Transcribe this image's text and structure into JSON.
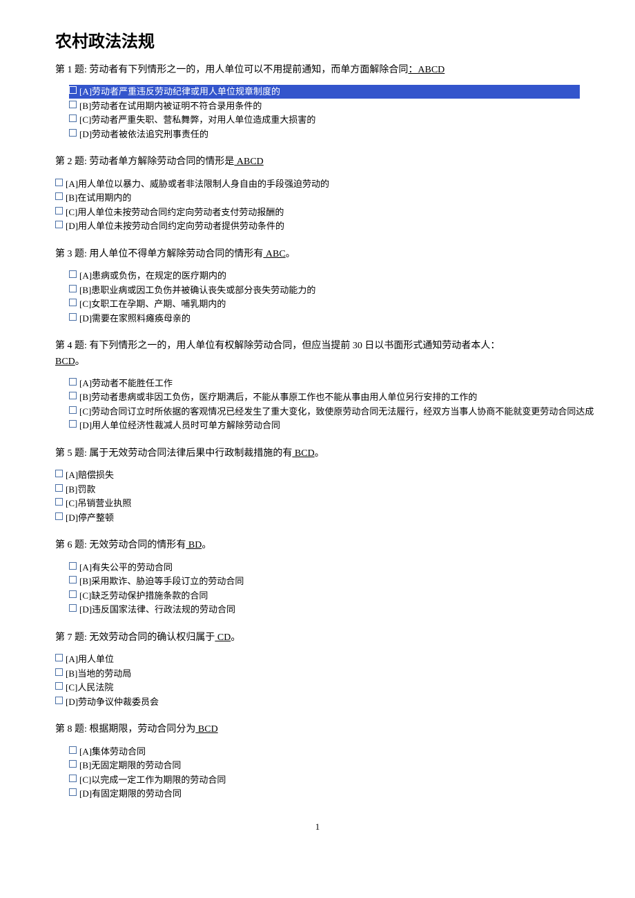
{
  "title": "农村政法法规",
  "page_number": "1",
  "questions": [
    {
      "number": "第 1 题:",
      "prompt": "劳动者有下列情形之一的，用人单位可以不用提前通知，而单方面解除合同",
      "answer": "：ABCD",
      "indent": true,
      "options": [
        {
          "label": "[A]劳动者严重违反劳动纪律或用人单位规章制度的",
          "highlighted": true
        },
        {
          "label": "[B]劳动者在试用期内被证明不符合录用条件的",
          "highlighted": false
        },
        {
          "label": "[C]劳动者严重失职、营私舞弊，对用人单位造成重大损害的",
          "highlighted": false
        },
        {
          "label": "[D]劳动者被依法追究刑事责任的",
          "highlighted": false
        }
      ]
    },
    {
      "number": "第 2 题:",
      "prompt": "劳动者单方解除劳动合同的情形是",
      "answer": " ABCD",
      "indent": false,
      "options": [
        {
          "label": "[A]用人单位以暴力、威胁或者非法限制人身自由的手段强迫劳动的",
          "highlighted": false
        },
        {
          "label": "[B]在试用期内的",
          "highlighted": false
        },
        {
          "label": "[C]用人单位未按劳动合同约定向劳动者支付劳动报酬的",
          "highlighted": false
        },
        {
          "label": "[D]用人单位未按劳动合同约定向劳动者提供劳动条件的",
          "highlighted": false
        }
      ]
    },
    {
      "number": "第 3 题:",
      "prompt": "用人单位不得单方解除劳动合同的情形有",
      "answer": " ABC",
      "suffix": "。",
      "indent": true,
      "options": [
        {
          "label": "[A]患病或负伤，在规定的医疗期内的",
          "highlighted": false
        },
        {
          "label": "[B]患职业病或因工负伤并被确认丧失或部分丧失劳动能力的",
          "highlighted": false
        },
        {
          "label": "[C]女职工在孕期、产期、哺乳期内的",
          "highlighted": false
        },
        {
          "label": "[D]需要在家照料瘫痪母亲的",
          "highlighted": false
        }
      ]
    },
    {
      "number": "第 4 题:",
      "prompt": "有下列情形之一的，用人单位有权解除劳动合同，但应当提前 30 日以书面形式通知劳动者本人：",
      "answer": "BCD",
      "suffix": "。",
      "answer_newline": true,
      "indent": true,
      "options": [
        {
          "label": "[A]劳动者不能胜任工作",
          "highlighted": false
        },
        {
          "label": "[B]劳动者患病或非因工负伤，医疗期满后，不能从事原工作也不能从事由用人单位另行安排的工作的",
          "highlighted": false
        },
        {
          "label": "[C]劳动合同订立时所依据的客观情况已经发生了重大变化，致使原劳动合同无法履行，经双方当事人协商不能就变更劳动合同达成",
          "highlighted": false
        },
        {
          "label": "[D]用人单位经济性裁减人员时可单方解除劳动合同",
          "highlighted": false
        }
      ]
    },
    {
      "number": "第 5 题:",
      "prompt": "属于无效劳动合同法律后果中行政制裁措施的有",
      "answer": " BCD",
      "suffix": "。",
      "indent": false,
      "options": [
        {
          "label": "[A]赔偿损失",
          "highlighted": false
        },
        {
          "label": "[B]罚款",
          "highlighted": false
        },
        {
          "label": "[C]吊销营业执照",
          "highlighted": false
        },
        {
          "label": "[D]停产整顿",
          "highlighted": false
        }
      ]
    },
    {
      "number": "第 6 题:",
      "prompt": "无效劳动合同的情形有",
      "answer": " BD",
      "suffix": "。",
      "indent": true,
      "options": [
        {
          "label": "[A]有失公平的劳动合同",
          "highlighted": false
        },
        {
          "label": "[B]采用欺诈、胁迫等手段订立的劳动合同",
          "highlighted": false
        },
        {
          "label": "[C]缺乏劳动保护措施条款的合同",
          "highlighted": false
        },
        {
          "label": "[D]违反国家法律、行政法规的劳动合同",
          "highlighted": false
        }
      ]
    },
    {
      "number": "第 7 题:",
      "prompt": "无效劳动合同的确认权归属于",
      "answer": " CD",
      "suffix": "。",
      "indent": false,
      "options": [
        {
          "label": "[A]用人单位",
          "highlighted": false
        },
        {
          "label": "[B]当地的劳动局",
          "highlighted": false
        },
        {
          "label": "[C]人民法院",
          "highlighted": false
        },
        {
          "label": "[D]劳动争议仲裁委员会",
          "highlighted": false
        }
      ]
    },
    {
      "number": "第 8 题:",
      "prompt": "根据期限，劳动合同分为",
      "answer": " BCD",
      "indent": true,
      "options": [
        {
          "label": "[A]集体劳动合同",
          "highlighted": false
        },
        {
          "label": "[B]无固定期限的劳动合同",
          "highlighted": false
        },
        {
          "label": "[C]以完成一定工作为期限的劳动合同",
          "highlighted": false
        },
        {
          "label": "[D]有固定期限的劳动合同",
          "highlighted": false
        }
      ]
    }
  ]
}
